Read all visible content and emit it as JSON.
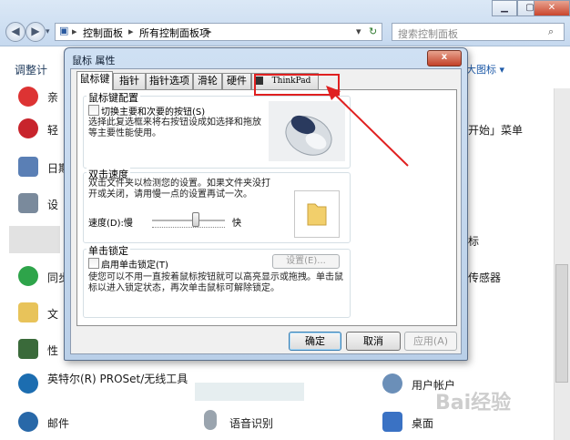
{
  "explorer": {
    "breadcrumb": [
      "控制面板",
      "所有控制面板项"
    ],
    "search_placeholder": "搜索控制面板",
    "adjust_label": "调整计",
    "view_label": "大图标 ▾",
    "left_items": [
      "亲",
      "轻",
      "日期",
      "设",
      "",
      "同步",
      "文",
      "性",
      "英特尔(R) PROSet/无线工具",
      "邮件"
    ],
    "right_items": [
      "开始」菜单",
      "标",
      "传感器",
      "用户帐户",
      "桌面"
    ],
    "bottom_middle_item": "语音识别"
  },
  "dialog": {
    "title": "鼠标 属性",
    "close_symbol": "x",
    "tabs": [
      "鼠标键",
      "指针",
      "指针选项",
      "滑轮",
      "硬件",
      "ThinkPad"
    ],
    "button_config": {
      "group_label": "鼠标键配置",
      "checkbox_label": "切换主要和次要的按钮(S)",
      "description": "选择此复选框来将右按钮设成如选择和拖放等主要性能使用。"
    },
    "double_click": {
      "group_label": "双击速度",
      "description": "双击文件夹以检测您的设置。如果文件夹没打开或关闭，请用慢一点的设置再试一次。",
      "speed_label": "速度(D):慢",
      "fast_label": "快",
      "speed_value": 0.6
    },
    "click_lock": {
      "group_label": "单击锁定",
      "checkbox_label": "启用单击锁定(T)",
      "settings_button": "设置(E)...",
      "description": "使您可以不用一直按着鼠标按钮就可以高亮显示或拖拽。单击鼠标以进入锁定状态，再次单击鼠标可解除锁定。"
    },
    "ok_button": "确定",
    "cancel_button": "取消",
    "apply_button": "应用(A)"
  },
  "watermark_text": "Bai经验"
}
